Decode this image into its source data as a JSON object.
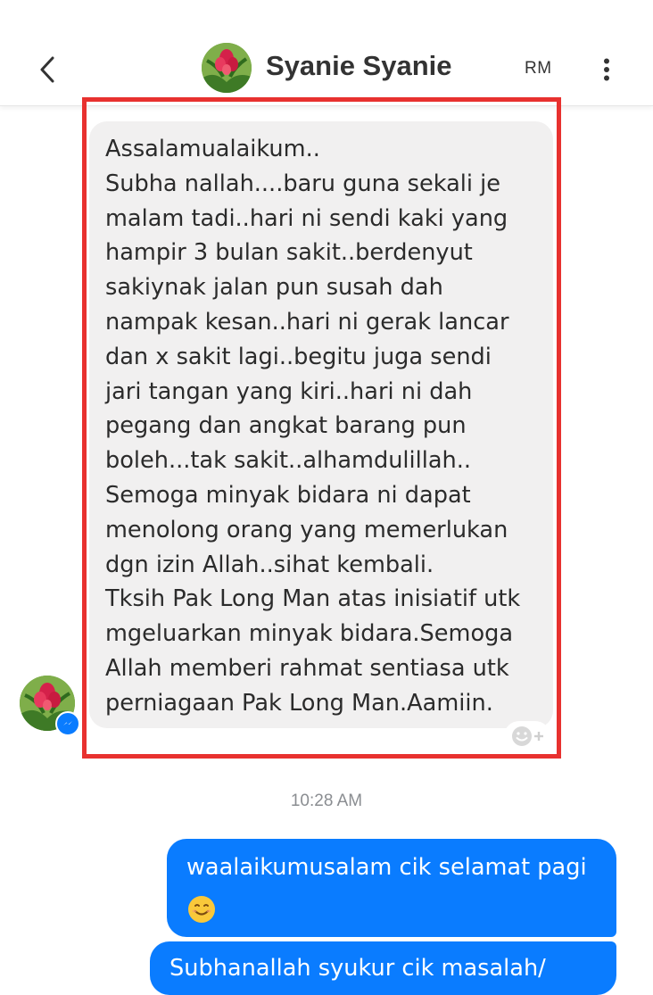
{
  "header": {
    "back_icon": "chevron-left-icon",
    "contact_name": "Syanie Syanie",
    "rm_label": "RM",
    "more_icon": "vertical-dots-icon"
  },
  "incoming_message": {
    "text": "Assalamualaikum..\nSubha nallah....baru guna sekali je\nmalam tadi..hari ni sendi kaki yang\nhampir 3 bulan sakit..berdenyut\nsakiynak jalan pun susah dah\nnampak kesan..hari ni gerak lancar\ndan x sakit lagi..begitu juga sendi\njari tangan yang kiri..hari ni dah\npegang dan angkat barang pun\nboleh...tak sakit..alhamdulillah..\nSemoga minyak bidara ni dapat\nmenolong orang yang memerlukan\ndgn izin Allah..sihat kembali.\nTksih Pak Long Man atas inisiatif utk\nmgeluarkan minyak bidara.Semoga\nAllah memberi rahmat sentiasa utk\nperniagaan Pak Long Man.Aamiin.",
    "react_icon": "add-reaction-icon",
    "highlight_color": "#e8312f"
  },
  "timestamp": "10:28 AM",
  "outgoing_messages": [
    {
      "text": "waalaikumusalam cik selamat pagi",
      "emoji": "😊"
    },
    {
      "text": "Subhanallah syukur cik masalah/"
    }
  ],
  "colors": {
    "outgoing_bubble": "#0a7cff",
    "incoming_bubble": "#f1f0f0",
    "messenger_badge": "#0a7cff"
  }
}
